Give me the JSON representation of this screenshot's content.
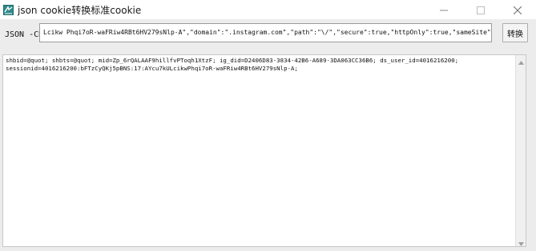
{
  "window": {
    "title": "json cookie转换标准cookie",
    "icon": "app-icon",
    "controls": {
      "minimize": "minimize-icon",
      "maximize": "maximize-icon",
      "close": "close-icon"
    }
  },
  "input_row": {
    "label": "JSON -CK",
    "value": "Lcikw Phqi7oR-waFRiw4RBt6HV279sNlp-A\",\"domain\":\".instagram.com\",\"path\":\"\\/\",\"secure\":true,\"httpOnly\":true,\"sameSite\":\"None\"}]",
    "button_label": "转换"
  },
  "output": {
    "lines": [
      "shbid=@quot; shbts=@quot; mid=Zp_6rQALAAF9hillfvPToqh1XtzF; ig_did=D2406D83-3834-42B6-A689-3DA063CC36B6; ds_user_id=4016216200;",
      "sessionid=4016216200:bFTzCyQKj5pBNS:17:AYcu7kULcikwPhqi7oR-waFRiw4RBt6HV279sNlp-A;"
    ]
  }
}
